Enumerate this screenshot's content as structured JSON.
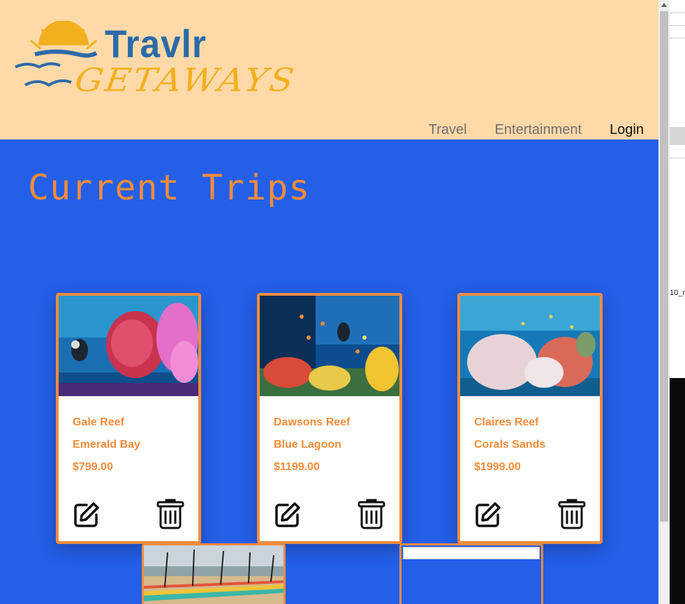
{
  "header": {
    "logo": {
      "brand": "Travlr",
      "tagline": "GETAWAYS"
    },
    "nav": [
      {
        "label": "Travel"
      },
      {
        "label": "Entertainment"
      },
      {
        "label": "Login"
      }
    ]
  },
  "main": {
    "title": "Current Trips",
    "trips": [
      {
        "name": "Gale Reef",
        "resort": "Emerald Bay",
        "price": "$799.00"
      },
      {
        "name": "Dawsons Reef",
        "resort": "Blue Lagoon",
        "price": "$1199.00"
      },
      {
        "name": "Claires Reef",
        "resort": "Corals Sands",
        "price": "$1999.00"
      }
    ]
  },
  "sidepanel": {
    "fragment": "10_n"
  },
  "colors": {
    "header_bg": "#ffd9a8",
    "page_bg": "#245fe8",
    "accent": "#f58c3c",
    "brand_blue": "#2c6aa8",
    "brand_yellow": "#f3b01e"
  }
}
